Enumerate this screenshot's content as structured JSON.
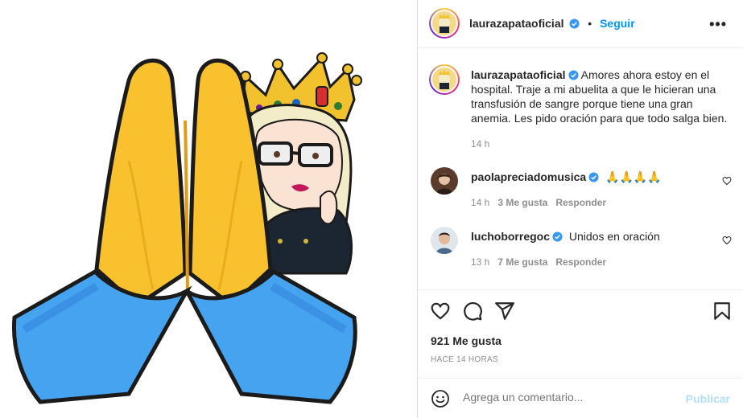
{
  "post": {
    "author": "laurazapataoficial",
    "follow_label": "Seguir",
    "more_label": "•••",
    "dot": "•",
    "caption": "Amores ahora estoy en el hospital. Traje a mi abuelita a que le hicieran una transfusión de sangre porque tiene una gran anemia. Les pido oración para que todo salga bien.",
    "caption_time": "14 h",
    "likes": "921 Me gusta",
    "posted_ago": "HACE 14 HORAS"
  },
  "comments": [
    {
      "user": "paolapreciadomusica",
      "text": "🙏🙏🙏🙏",
      "time": "14 h",
      "likes": "3 Me gusta",
      "reply": "Responder"
    },
    {
      "user": "luchoborregoc",
      "text": "Unidos en oración",
      "time": "13 h",
      "likes": "7 Me gusta",
      "reply": "Responder"
    }
  ],
  "composer": {
    "placeholder": "Agrega un comentario...",
    "publish_label": "Publicar"
  },
  "colors": {
    "link_blue": "#0095f6",
    "publish_disabled": "#b2dffc",
    "verified_blue": "#3897f0"
  },
  "icons": {
    "like": "heart-icon",
    "comment": "comment-icon",
    "share": "share-icon",
    "save": "bookmark-icon",
    "emoji": "emoji-icon"
  }
}
